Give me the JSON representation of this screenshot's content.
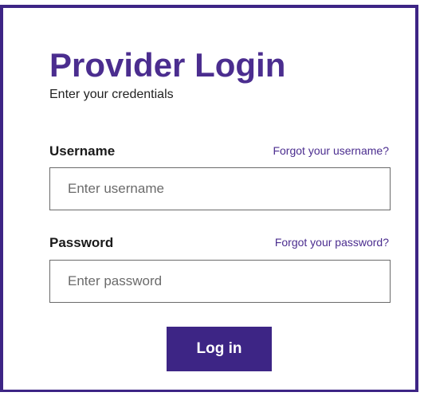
{
  "login": {
    "title": "Provider Login",
    "subtitle": "Enter your credentials",
    "username": {
      "label": "Username",
      "forgot_link": "Forgot your username?",
      "placeholder": "Enter username",
      "value": ""
    },
    "password": {
      "label": "Password",
      "forgot_link": "Forgot your password?",
      "placeholder": "Enter password",
      "value": ""
    },
    "submit_label": "Log in"
  },
  "colors": {
    "brand_purple": "#4b2d8f",
    "border_purple": "#3d2585",
    "button_background": "#3d2585",
    "button_text": "#ffffff",
    "input_border": "#6a6a6a"
  }
}
